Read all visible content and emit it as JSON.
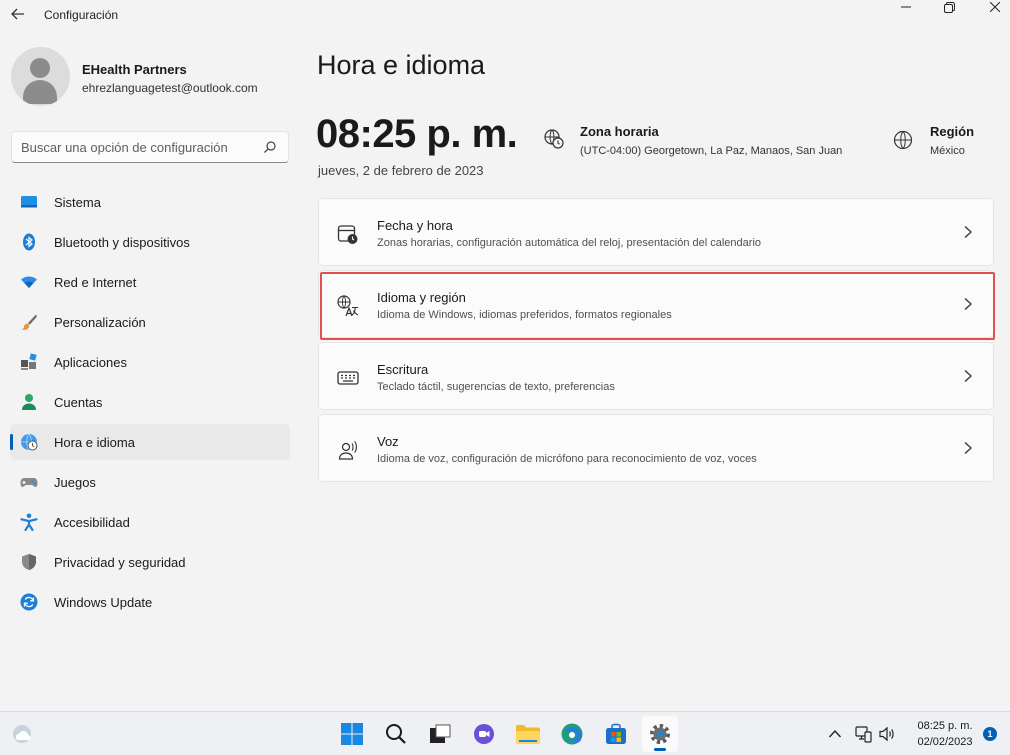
{
  "window": {
    "title": "Configuración"
  },
  "profile": {
    "name": "EHealth Partners",
    "email": "ehrezlanguagetest@outlook.com"
  },
  "search": {
    "placeholder": "Buscar una opción de configuración"
  },
  "sidebar": {
    "items": [
      {
        "label": "Sistema",
        "icon": "system-icon"
      },
      {
        "label": "Bluetooth y dispositivos",
        "icon": "bluetooth-icon"
      },
      {
        "label": "Red e Internet",
        "icon": "wifi-icon"
      },
      {
        "label": "Personalización",
        "icon": "brush-icon"
      },
      {
        "label": "Aplicaciones",
        "icon": "apps-icon"
      },
      {
        "label": "Cuentas",
        "icon": "accounts-icon"
      },
      {
        "label": "Hora e idioma",
        "icon": "time-language-icon",
        "active": true
      },
      {
        "label": "Juegos",
        "icon": "gamepad-icon"
      },
      {
        "label": "Accesibilidad",
        "icon": "accessibility-icon"
      },
      {
        "label": "Privacidad y seguridad",
        "icon": "shield-icon"
      },
      {
        "label": "Windows Update",
        "icon": "update-icon"
      }
    ]
  },
  "main": {
    "title": "Hora e idioma",
    "clock": "08:25 p. m.",
    "date": "jueves, 2 de febrero de 2023",
    "timezone": {
      "title": "Zona horaria",
      "value": "(UTC-04:00) Georgetown, La Paz, Manaos, San Juan"
    },
    "region": {
      "title": "Región",
      "value": "México"
    },
    "cards": [
      {
        "title": "Fecha y hora",
        "subtitle": "Zonas horarias, configuración automática del reloj, presentación del calendario",
        "icon": "calendar-clock-icon"
      },
      {
        "title": "Idioma y región",
        "subtitle": "Idioma de Windows, idiomas preferidos, formatos regionales",
        "icon": "language-icon",
        "highlighted": true
      },
      {
        "title": "Escritura",
        "subtitle": "Teclado táctil, sugerencias de texto, preferencias",
        "icon": "keyboard-icon"
      },
      {
        "title": "Voz",
        "subtitle": "Idioma de voz, configuración de micrófono para reconocimiento de voz, voces",
        "icon": "speech-icon"
      }
    ]
  },
  "taskbar": {
    "time": "08:25 p. m.",
    "date": "02/02/2023",
    "notification_count": "1",
    "accent": "#005fb8"
  },
  "colors": {
    "accent": "#005fb8",
    "highlight_border": "#e05151",
    "background": "#f3f3f3"
  }
}
